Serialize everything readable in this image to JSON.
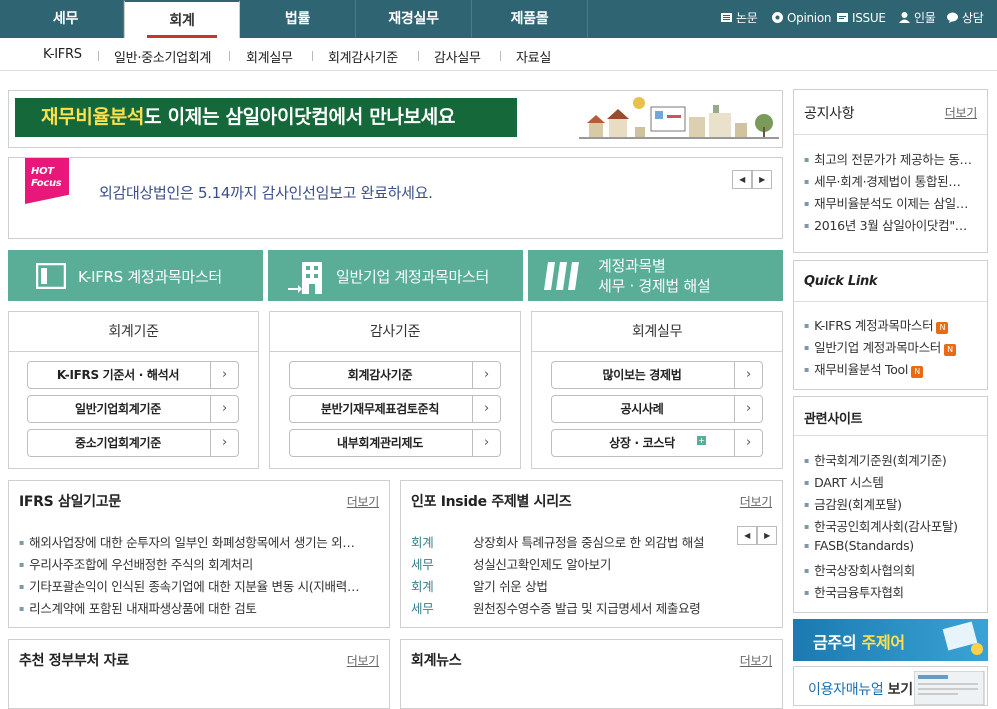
{
  "top_nav": {
    "tabs": [
      "세무",
      "회계",
      "법률",
      "재경실무",
      "제품몰"
    ],
    "active_tab": "회계",
    "utility": [
      "논문",
      "Opinion",
      "ISSUE",
      "인물",
      "상담"
    ]
  },
  "sub_nav": [
    "K-IFRS",
    "일반·중소기업회계",
    "회계실무",
    "회계감사기준",
    "감사실무",
    "자료실"
  ],
  "banner": {
    "highlight": "재무비율분석",
    "text": "도 이제는 삼일아이닷컴에서 만나보세요"
  },
  "hot_focus": {
    "badge_line1": "HOT",
    "badge_line2": "Focus",
    "text": "외감대상법인은 5.14까지 감사인선임보고 완료하세요."
  },
  "green_buttons": [
    {
      "label": "K-IFRS 계정과목마스터",
      "icon": "document-icon"
    },
    {
      "label": "일반기업 계정과목마스터",
      "icon": "building-icon"
    },
    {
      "line1": "계정과목별",
      "line2": "세무 · 경제법 해설",
      "icon": "stripes-icon"
    }
  ],
  "panels": [
    {
      "title": "회계기준",
      "items": [
        "K-IFRS 기준서 · 해석서",
        "일반기업회계기준",
        "중소기업회계기준"
      ]
    },
    {
      "title": "감사기준",
      "items": [
        "회계감사기준",
        "분반기재무제표검토준칙",
        "내부회계관리제도"
      ]
    },
    {
      "title": "회계실무",
      "items": [
        "많이보는 경제법",
        "공시사례",
        "상장 · 코스닥"
      ]
    }
  ],
  "ifrs_column": {
    "title": "IFRS 삼일기고문",
    "more": "더보기",
    "items": [
      "해외사업장에 대한 순투자의 일부인 화폐성항목에서 생기는 외…",
      "우리사주조합에 우선배정한 주식의 회계처리",
      "기타포괄손익이 인식된 종속기업에 대한 지분율 변동 시(지배력…",
      "리스계약에 포함된 내재파생상품에 대한 검토"
    ]
  },
  "inside_series": {
    "title": "인포 Inside 주제별 시리즈",
    "more": "더보기",
    "items": [
      {
        "category": "회계",
        "text": "상장회사 특례규정을 중심으로 한 외감법 해설"
      },
      {
        "category": "세무",
        "text": "성실신고확인제도 알아보기"
      },
      {
        "category": "회계",
        "text": "알기 쉬운 상법"
      },
      {
        "category": "세무",
        "text": "원천징수영수증 발급 및 지급명세서 제출요령"
      }
    ]
  },
  "gov_docs": {
    "title": "추천 정부부처 자료",
    "more": "더보기"
  },
  "acct_news": {
    "title": "회계뉴스",
    "more": "더보기"
  },
  "notice": {
    "title": "공지사항",
    "more": "더보기",
    "items": [
      "최고의 전문가가 제공하는 동…",
      "세무·회계·경제법이 통합된…",
      "재무비율분석도 이제는 삼일…",
      "2016년 3월 삼일아이닷컴\"…"
    ]
  },
  "quick_link": {
    "title": "Quick Link",
    "items": [
      "K-IFRS 계정과목마스터",
      "일반기업 계정과목마스터",
      "재무비율분석 Tool"
    ],
    "badge": "N"
  },
  "related_sites": {
    "title": "관련사이트",
    "items": [
      "한국회계기준원(회계기준)",
      "DART 시스템",
      "금감원(회계포탈)",
      "한국공인회계사회(감사포탈)",
      "FASB(Standards)",
      "한국상장회사협의회",
      "한국금융투자협회"
    ]
  },
  "promo1": {
    "part1": "금주의",
    "part2": "주제어"
  },
  "promo2": {
    "part1": "이용자매뉴얼",
    "part2": "보기"
  },
  "colors": {
    "nav": "#2f6473",
    "green_button": "#5aae97",
    "banner": "#14683a",
    "hot": "#e8177a"
  }
}
